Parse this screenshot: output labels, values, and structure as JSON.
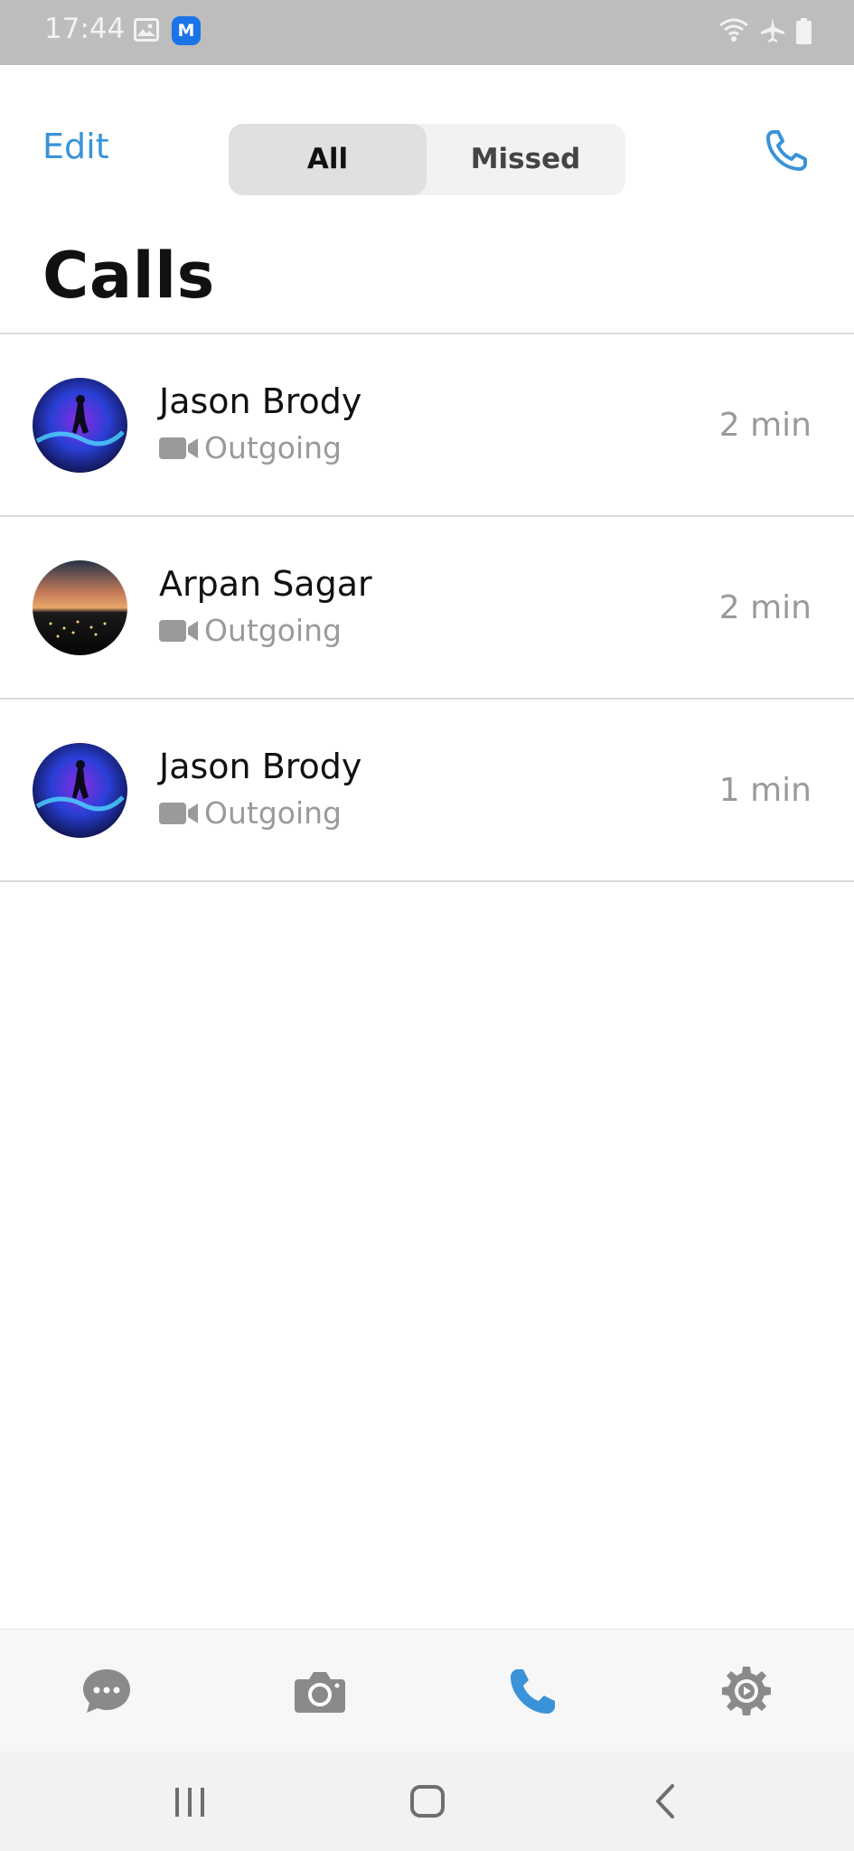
{
  "status_bar": {
    "time": "17:44",
    "icons": [
      "gallery-icon",
      "app-notification-icon",
      "wifi-icon",
      "airplane-mode-icon",
      "battery-icon"
    ],
    "app_badge": "M"
  },
  "header": {
    "edit_label": "Edit",
    "segments": [
      {
        "label": "All",
        "selected": true
      },
      {
        "label": "Missed",
        "selected": false
      }
    ],
    "new_call_icon": "phone-icon",
    "title": "Calls"
  },
  "calls": [
    {
      "name": "Jason Brody",
      "type": "Outgoing",
      "type_icon": "video-camera-icon",
      "duration": "2 min",
      "avatar": "space-figure-avatar"
    },
    {
      "name": "Arpan Sagar",
      "type": "Outgoing",
      "type_icon": "video-camera-icon",
      "duration": "2 min",
      "avatar": "city-sunset-avatar"
    },
    {
      "name": "Jason Brody",
      "type": "Outgoing",
      "type_icon": "video-camera-icon",
      "duration": "1 min",
      "avatar": "space-figure-avatar"
    }
  ],
  "tab_bar": {
    "items": [
      {
        "name": "chats",
        "icon": "chat-bubble-icon",
        "active": false
      },
      {
        "name": "camera",
        "icon": "camera-icon",
        "active": false
      },
      {
        "name": "calls",
        "icon": "phone-icon",
        "active": true
      },
      {
        "name": "settings",
        "icon": "gear-icon",
        "active": false
      }
    ]
  },
  "nav_bar": {
    "buttons": [
      "recent-apps-icon",
      "home-icon",
      "back-icon"
    ]
  },
  "colors": {
    "accent": "#3a93d8",
    "status_bar": "#bdbdbd",
    "secondary_text": "#9a9a9a",
    "inactive_icon": "#8a8a8a"
  }
}
